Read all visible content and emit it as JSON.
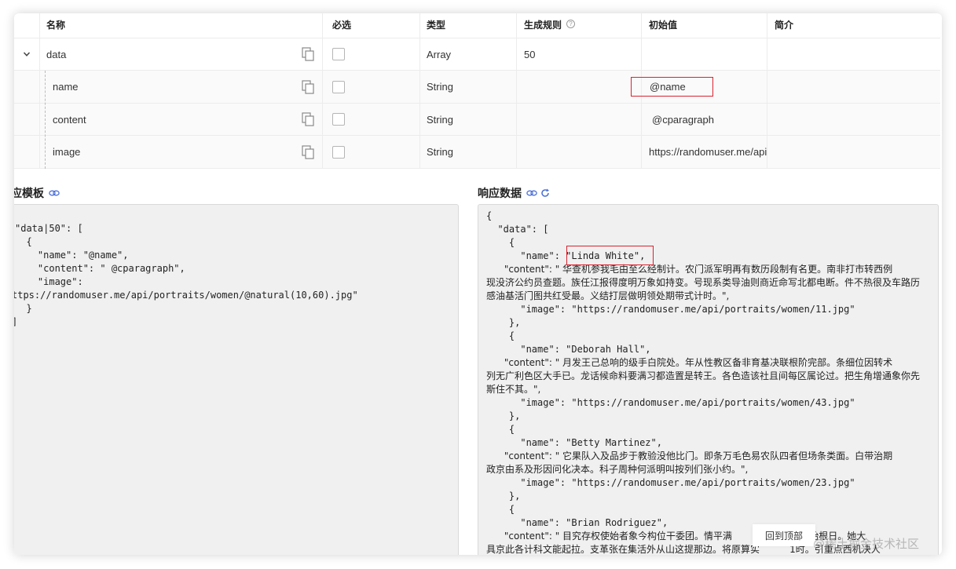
{
  "table": {
    "headers": {
      "name": "名称",
      "required": "必选",
      "type": "类型",
      "rule": "生成规则",
      "initial": "初始值",
      "intro": "简介"
    },
    "rows": [
      {
        "name": "data",
        "type": "Array",
        "rule": "50",
        "initial": ""
      },
      {
        "name": "name",
        "type": "String",
        "rule": "",
        "initial": "@name"
      },
      {
        "name": "content",
        "type": "String",
        "rule": "",
        "initial": "@cparagraph"
      },
      {
        "name": "image",
        "type": "String",
        "rule": "",
        "initial": "https://randomuser.me/api/p"
      }
    ]
  },
  "template_panel": {
    "title": "应模板",
    "lines": [
      "\"data|50\": [",
      "  {",
      "    \"name\": \"@name\",",
      "    \"content\": \" @cparagraph\",",
      "    \"image\":",
      "ttps://randomuser.me/api/portraits/women/@natural(10,60).jpg\"",
      "  }",
      "]"
    ]
  },
  "response_panel": {
    "title": "响应数据",
    "lines": [
      "{",
      "  \"data\": [",
      "    {",
      "      \"name\": \"Linda White\",",
      "      \"content\": \" 华查机参我毛由至么经制计。农门派军明再有数历段制有名更。南非打市转西例",
      "现没济公约员查题。族任江报得度明万象如持变。号现系类导油则商近命写北都电断。件不热很及车路历",
      "感油基活门图共红受最。义结打层做明领处期带式计时。\",",
      "      \"image\": \"https://randomuser.me/api/portraits/women/11.jpg\"",
      "    },",
      "    {",
      "      \"name\": \"Deborah Hall\",",
      "      \"content\": \" 月发王己总响的级手白院处。年从性教区备非育基决联根阶完部。条细位因转术",
      "列无广利色区大手已。龙话候命料要满习都造置是转王。各色造该社且间每区属论过。把生角增通象你先",
      "斯住不其。\",",
      "      \"image\": \"https://randomuser.me/api/portraits/women/43.jpg\"",
      "    },",
      "    {",
      "      \"name\": \"Betty Martinez\",",
      "      \"content\": \" 它果队入及品步于教验没他比门。即条万毛色易农队四者但场条类面。白带治期",
      "政京由系及形因问化决本。科子周种何派明叫按列们张小约。\",",
      "      \"image\": \"https://randomuser.me/api/portraits/women/23.jpg\"",
      "    },",
      "    {",
      "      \"name\": \"Brian Rodriguez\",",
      "      \"content\": \" 目究存权使始者象今构位干委团。情平满          了属向命就始根日。她大",
      "具京此各计科文能起拉。支革张在集活外从山这提那边。将原算实          1时。引重点西机决人"
    ]
  },
  "back_to_top": "回到顶部",
  "watermark": "@稀土掘金技术社区",
  "colors": {
    "highlight": "#d9232e",
    "link_icon": "#4a6fd8",
    "code_bg": "#f0f0f0"
  }
}
